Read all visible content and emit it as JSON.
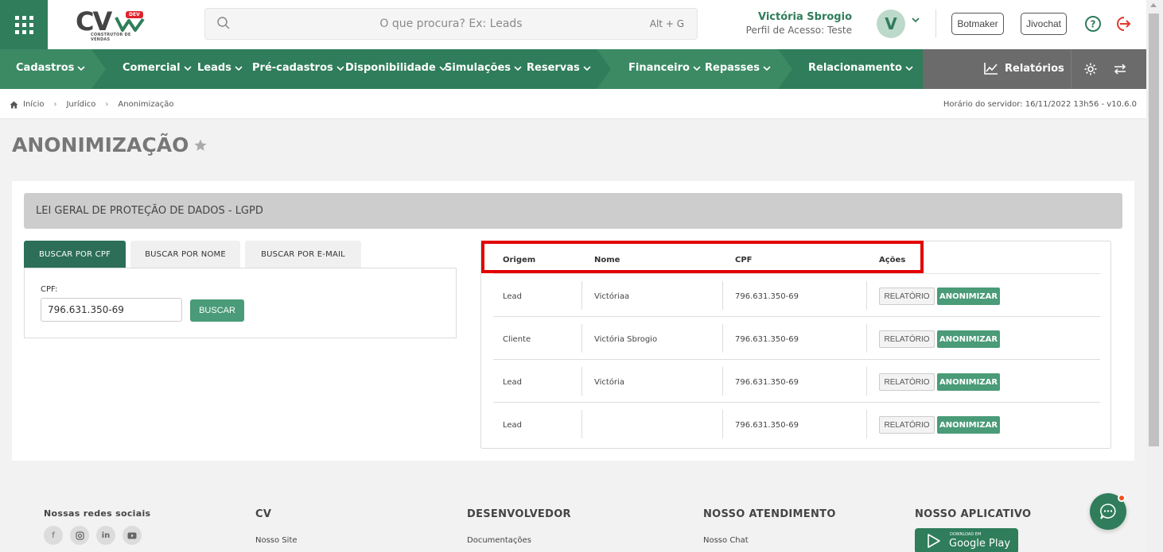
{
  "header": {
    "logo_text": "CV",
    "logo_badge": "DEV",
    "logo_subtitle": "CONSTRUTOR DE VENDAS",
    "search_placeholder": "O que procura? Ex: Leads",
    "search_shortcut": "Alt + G",
    "user_name": "Victória Sbrogio",
    "user_profile": "Perfil de Acesso: Teste",
    "avatar_initial": "V",
    "botmaker_label": "Botmaker",
    "jivochat_label": "Jivochat"
  },
  "nav": {
    "items": [
      "Cadastros",
      "Comercial",
      "Leads",
      "Pré-cadastros",
      "Disponibilidade",
      "Simulações",
      "Reservas",
      "Financeiro",
      "Repasses",
      "Relacionamento"
    ],
    "reports_label": "Relatórios"
  },
  "breadcrumb": {
    "items": [
      "Início",
      "Jurídico",
      "Anonimização"
    ],
    "server_time": "Horário do servidor: 16/11/2022 13h56 - v10.6.0"
  },
  "page": {
    "title": "ANONIMIZAÇÃO",
    "section_title": "LEI GERAL DE PROTEÇÃO DE DADOS - LGPD"
  },
  "search_form": {
    "tabs": [
      "BUSCAR POR CPF",
      "BUSCAR POR NOME",
      "BUSCAR POR E-MAIL"
    ],
    "active_tab": "BUSCAR POR CPF",
    "cpf_label": "CPF:",
    "cpf_value": "796.631.350-69",
    "search_button": "BUSCAR"
  },
  "results": {
    "columns": [
      "Origem",
      "Nome",
      "CPF",
      "Ações"
    ],
    "rows": [
      {
        "origem": "Lead",
        "nome": "Victóriaa",
        "cpf": "796.631.350-69"
      },
      {
        "origem": "Cliente",
        "nome": "Victória Sbrogio",
        "cpf": "796.631.350-69"
      },
      {
        "origem": "Lead",
        "nome": "Victória",
        "cpf": "796.631.350-69"
      },
      {
        "origem": "Lead",
        "nome": "",
        "cpf": "796.631.350-69"
      }
    ],
    "report_button": "RELATÓRIO",
    "anonymize_button": "ANONIMIZAR"
  },
  "footer": {
    "social_title": "Nossas redes sociais",
    "cv_title": "CV",
    "cv_link": "Nosso Site",
    "dev_title": "DESENVOLVEDOR",
    "dev_link": "Documentações",
    "support_title": "NOSSO ATENDIMENTO",
    "support_link": "Nosso Chat",
    "app_title": "NOSSO APLICATIVO",
    "gplay_small": "DOWNLOAD EM",
    "gplay_label": "Google Play"
  },
  "colors": {
    "primary_green": "#2f7d5a",
    "button_green": "#4a9b78",
    "highlight_red": "#e30000"
  }
}
